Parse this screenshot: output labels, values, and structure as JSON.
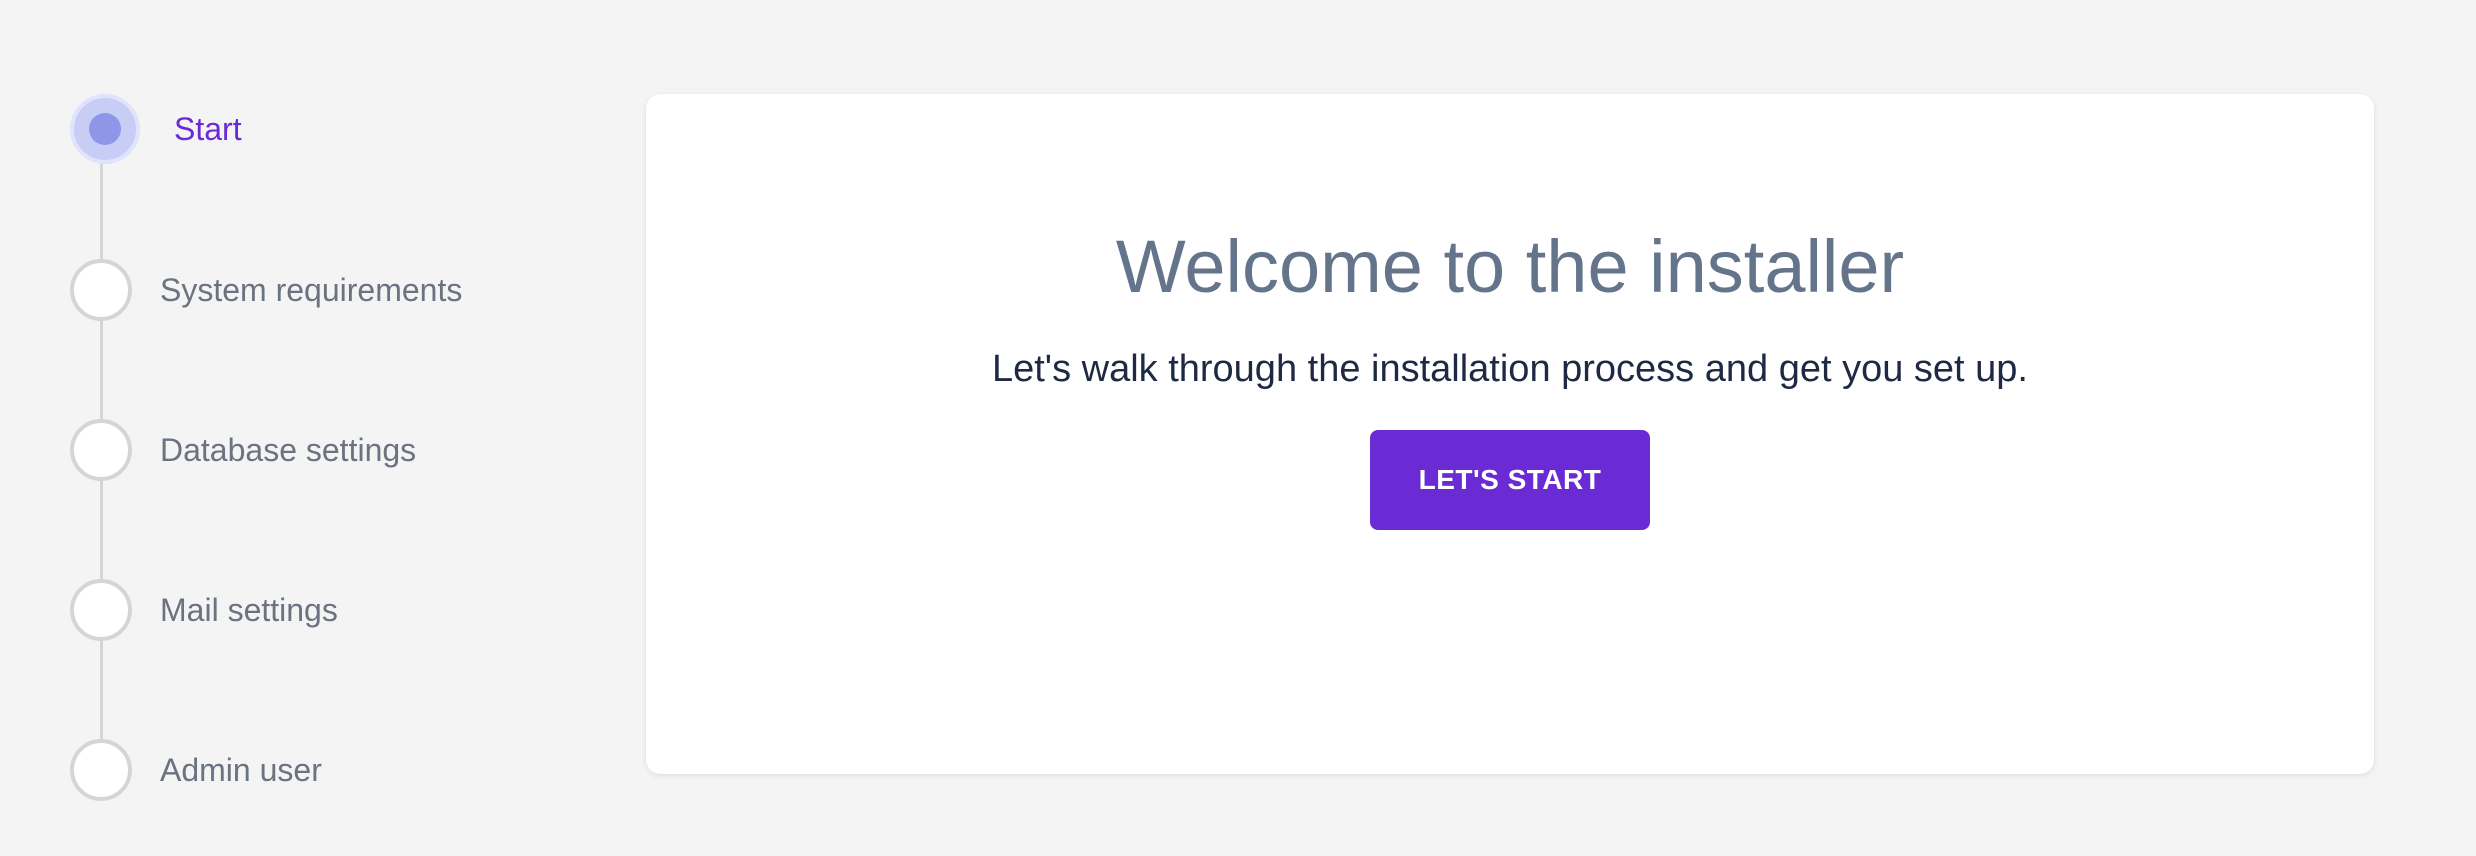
{
  "stepper": {
    "steps": [
      {
        "label": "Start",
        "state": "active"
      },
      {
        "label": "System requirements",
        "state": "pending"
      },
      {
        "label": "Database settings",
        "state": "pending"
      },
      {
        "label": "Mail settings",
        "state": "pending"
      },
      {
        "label": "Admin user",
        "state": "pending"
      }
    ]
  },
  "card": {
    "title": "Welcome to the installer",
    "subtitle": "Let's walk through the installation process and get you set up.",
    "start_button_label": "LET'S START"
  },
  "colors": {
    "accent": "#6a2bd4",
    "background": "#f4f4f4",
    "active_step_fill": "#c7cdf5",
    "active_step_dot": "#8f96e8",
    "title_text": "#64748b",
    "subtitle_text": "#1e2a44",
    "step_text": "#6b7280"
  }
}
